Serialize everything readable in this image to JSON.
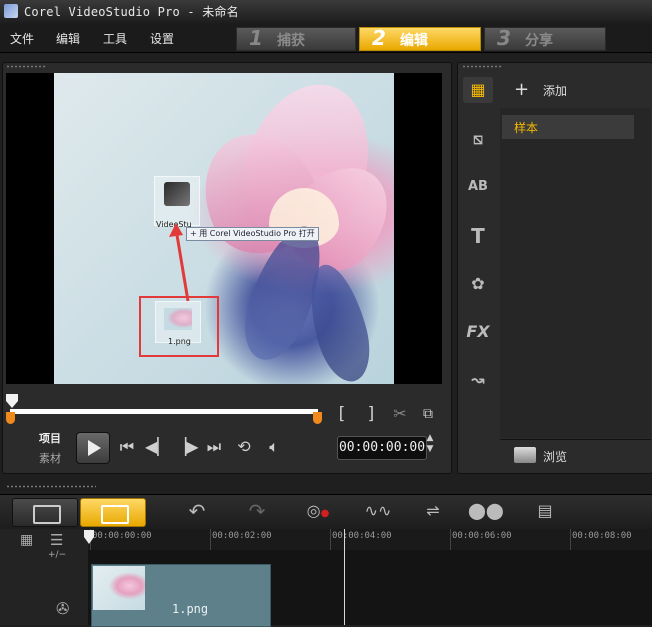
{
  "window": {
    "title": "Corel VideoStudio Pro - 未命名"
  },
  "menu": {
    "items": [
      "文件",
      "编辑",
      "工具",
      "设置"
    ]
  },
  "steps": [
    {
      "number": "1",
      "label": "捕获",
      "active": false
    },
    {
      "number": "2",
      "label": "编辑",
      "active": true
    },
    {
      "number": "3",
      "label": "分享",
      "active": false
    }
  ],
  "preview": {
    "desktop_icons": [
      {
        "label": "VideoStu",
        "type": "app"
      },
      {
        "label": "1.png",
        "type": "image"
      }
    ],
    "tooltip": "+ 用 Corel VideoStudio Pro 打开"
  },
  "playback": {
    "mode_project": "项目",
    "mode_clip": "素材",
    "timecode": "00:00:00:00",
    "mark_in": "[",
    "mark_out": "]"
  },
  "library": {
    "add_label": "添加",
    "folders": [
      "样本"
    ],
    "browse_label": "浏览",
    "side_icons": [
      "media-icon",
      "transition-icon",
      "title-ab-icon",
      "title-t-icon",
      "graphic-icon",
      "fx-icon",
      "path-icon"
    ]
  },
  "timeline": {
    "toolbar_icons": [
      "storyboard-view-icon",
      "timeline-view-icon",
      "undo-icon",
      "redo-icon",
      "record-capture-icon",
      "audio-mixer-icon",
      "auto-music-icon",
      "motion-track-icon",
      "subtitle-icon"
    ],
    "ruler_labels": [
      "00:00:00:00",
      "00:00:02:00",
      "00:00:04:00",
      "00:00:06:00",
      "00:00:08:00"
    ],
    "zoom_label": "+/−",
    "clips": [
      {
        "label": "1.png"
      }
    ]
  },
  "colors": {
    "accent": "#f5b800",
    "marker": "#f08a1c",
    "highlight": "#e23a3a",
    "clip": "#5d808a"
  }
}
